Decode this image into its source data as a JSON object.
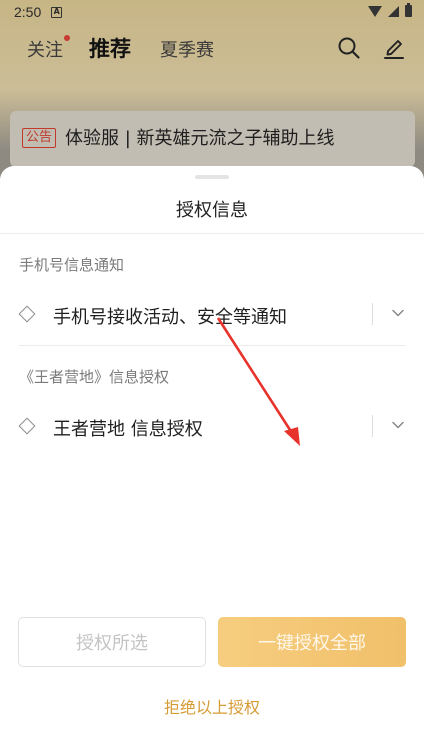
{
  "status_bar": {
    "time": "2:50",
    "notification": "A"
  },
  "nav": {
    "tabs": [
      {
        "label": "关注"
      },
      {
        "label": "推荐"
      },
      {
        "label": "夏季赛"
      }
    ]
  },
  "notice": {
    "tag": "公告",
    "text": "体验服 | 新英雄元流之子辅助上线"
  },
  "sheet": {
    "title": "授权信息",
    "sections": [
      {
        "label": "手机号信息通知",
        "option": "手机号接收活动、安全等通知"
      },
      {
        "label": "《王者营地》信息授权",
        "option": "王者营地 信息授权"
      }
    ],
    "buttons": {
      "authorize_selected": "授权所选",
      "authorize_all": "一键授权全部"
    },
    "reject": "拒绝以上授权"
  },
  "colors": {
    "accent": "#d79b36",
    "primary_button": "#f3c674",
    "annotation_arrow": "#e8322c"
  },
  "icons": [
    "search-icon",
    "edit-icon",
    "chevron-down-icon",
    "diamond-checkbox-icon",
    "wifi-icon",
    "signal-icon",
    "battery-icon"
  ]
}
